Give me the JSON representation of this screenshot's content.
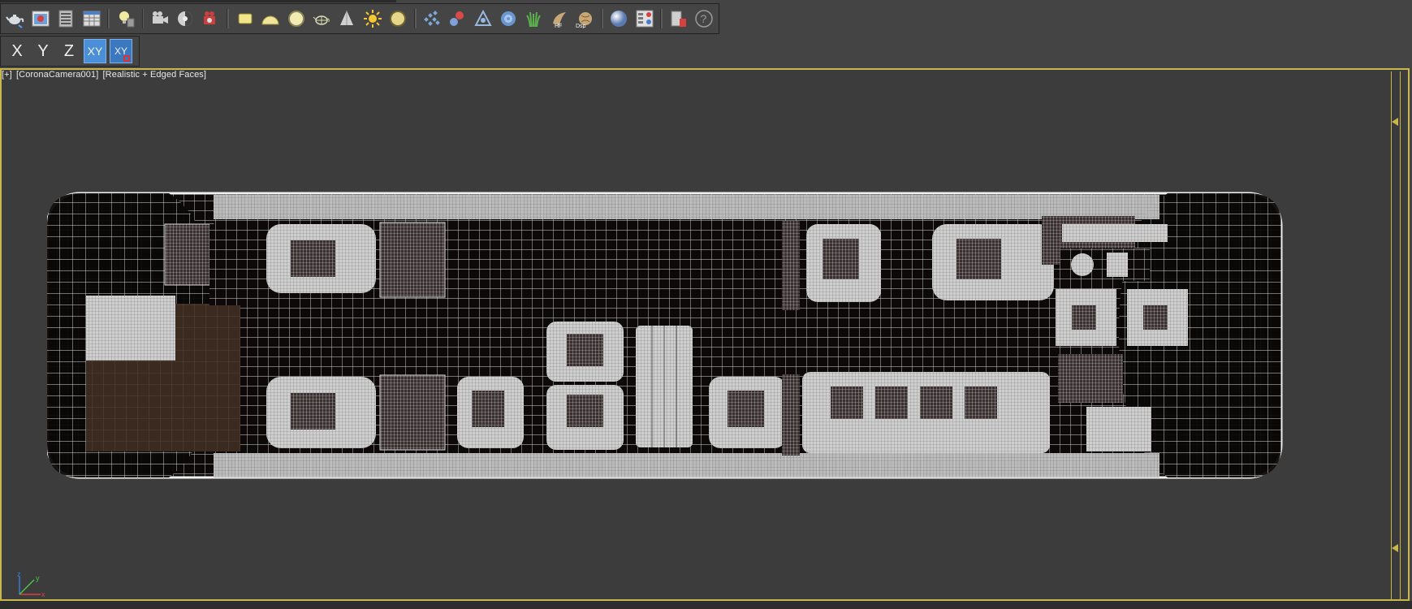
{
  "main_toolbar": {
    "buttons": [
      {
        "name": "teapot-render-icon",
        "group": 1
      },
      {
        "name": "render-frame-window-icon",
        "group": 1
      },
      {
        "name": "render-setup-icon",
        "group": 1
      },
      {
        "name": "render-messages-icon",
        "group": 1
      },
      {
        "name": "light-lister-icon",
        "group": 2
      },
      {
        "name": "camera-icon",
        "group": 3
      },
      {
        "name": "interactive-render-icon",
        "group": 3
      },
      {
        "name": "render-camera-icon",
        "group": 3
      },
      {
        "name": "plane-light-icon",
        "group": 4
      },
      {
        "name": "dome-light-icon",
        "group": 4
      },
      {
        "name": "sphere-light-icon",
        "group": 4
      },
      {
        "name": "teapot-light-icon",
        "group": 4
      },
      {
        "name": "cone-light-icon",
        "group": 4
      },
      {
        "name": "sun-icon",
        "group": 4
      },
      {
        "name": "disc-light-icon",
        "group": 4
      },
      {
        "name": "scatter-icon",
        "group": 5
      },
      {
        "name": "proxy-icon",
        "group": 5
      },
      {
        "name": "distance-icon",
        "group": 5
      },
      {
        "name": "pattern-icon",
        "group": 5
      },
      {
        "name": "grass-icon",
        "group": 5
      },
      {
        "name": "hair-fur-icon",
        "group": 5
      },
      {
        "name": "displacement-icon",
        "group": 5
      },
      {
        "name": "material-sphere-icon",
        "group": 6
      },
      {
        "name": "material-library-icon",
        "group": 6
      },
      {
        "name": "converter-icon",
        "group": 7
      },
      {
        "name": "help-icon",
        "group": 7
      }
    ]
  },
  "axis_toolbar": {
    "x_label": "X",
    "y_label": "Y",
    "z_label": "Z",
    "xy_label": "XY",
    "xy_lock_label": "XY"
  },
  "viewport": {
    "plus": "[+]",
    "camera": "[CoronaCamera001]",
    "shading": "[Realistic + Edged Faces]"
  },
  "gizmo": {
    "x": "x",
    "y": "y",
    "z": "z"
  },
  "colors": {
    "ui_bg": "#444444",
    "toolbar_bg": "#454545",
    "viewport_border": "#c8b74a",
    "active_axis": "#4a8fd8",
    "wireframe": "#f2f2f2",
    "fuselage_dark": "#0c0908"
  }
}
